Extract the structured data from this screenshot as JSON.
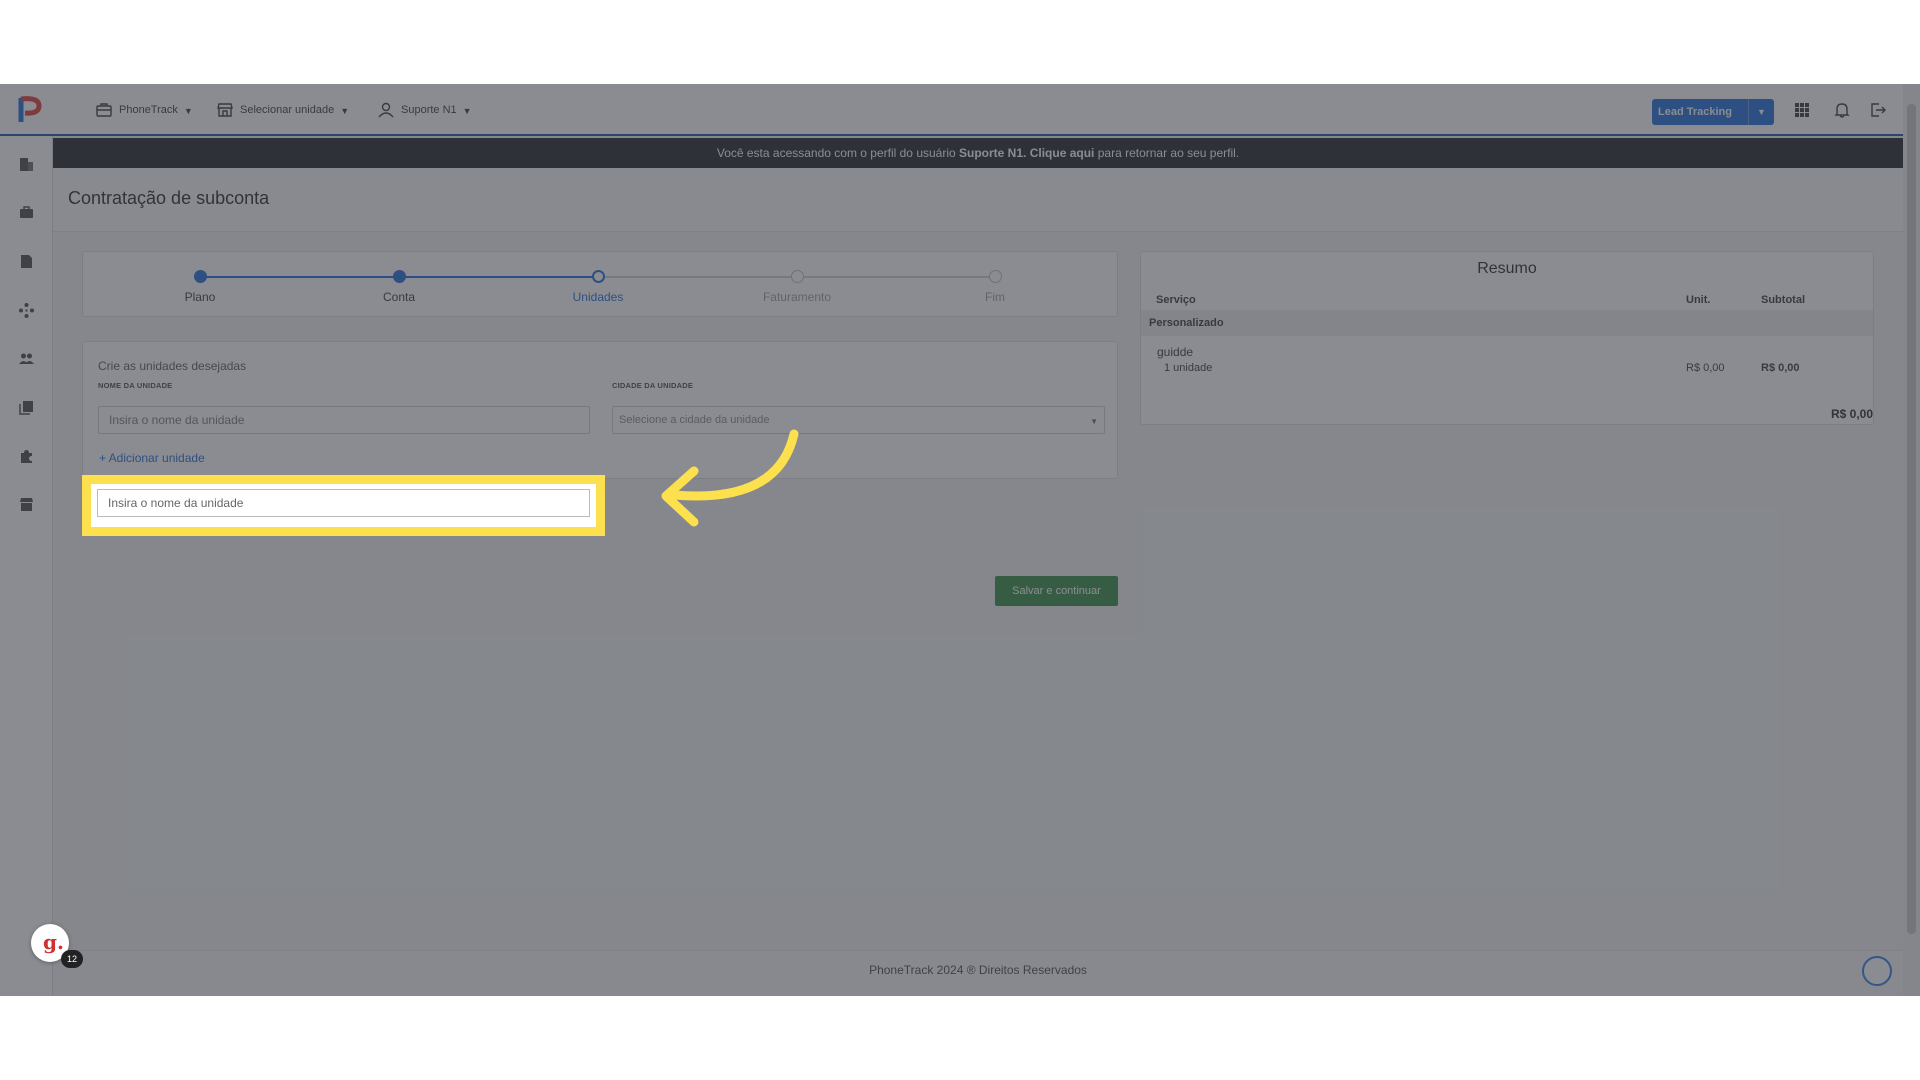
{
  "colors": {
    "brand_blue": "#1b66d6",
    "highlight_yellow": "#fde04d",
    "save_green": "#2e8b3e",
    "banner_dark": "#1c1c22"
  },
  "topbar": {
    "menu_account": "PhoneTrack",
    "menu_unit": "Selecionar unidade",
    "menu_user": "Suporte N1",
    "lead_tracking": "Lead Tracking",
    "icons": [
      "briefcase-icon",
      "store-icon",
      "user-icon",
      "apps-grid-icon",
      "bell-icon",
      "logout-icon"
    ]
  },
  "sidebar_icons": [
    "building-icon",
    "briefcase-icon",
    "document-icon",
    "network-icon",
    "users-icon",
    "library-icon",
    "puzzle-icon",
    "store-icon"
  ],
  "banner": {
    "prefix": "Você esta acessando com o perfil do usuário",
    "user": "Suporte N1.",
    "link": "Clique aqui",
    "suffix": "para retornar ao seu perfil."
  },
  "page_title": "Contratação de subconta",
  "steps": [
    {
      "label": "Plano",
      "state": "done"
    },
    {
      "label": "Conta",
      "state": "done"
    },
    {
      "label": "Unidades",
      "state": "current"
    },
    {
      "label": "Faturamento",
      "state": "pending"
    },
    {
      "label": "Fim",
      "state": "pending"
    }
  ],
  "form": {
    "hint": "Crie as unidades desejadas",
    "name_label": "NOME DA UNIDADE",
    "name_placeholder": "Insira o nome da unidade",
    "city_label": "CIDADE DA UNIDADE",
    "city_placeholder": "Selecione a cidade da unidade",
    "add_unit": "+ Adicionar unidade",
    "save": "Salvar e continuar"
  },
  "summary": {
    "title": "Resumo",
    "col_service": "Serviço",
    "col_unit": "Unit.",
    "col_subtotal": "Subtotal",
    "category": "Personalizado",
    "item_name": "guidde",
    "item_qty": "1 unidade",
    "item_unit": "R$ 0,00",
    "item_subtotal": "R$ 0,00",
    "total": "R$ 0,00"
  },
  "footer": {
    "text": "PhoneTrack 2024 ® Direitos Reservados"
  },
  "guidde": {
    "letter": "g.",
    "count": "12"
  }
}
